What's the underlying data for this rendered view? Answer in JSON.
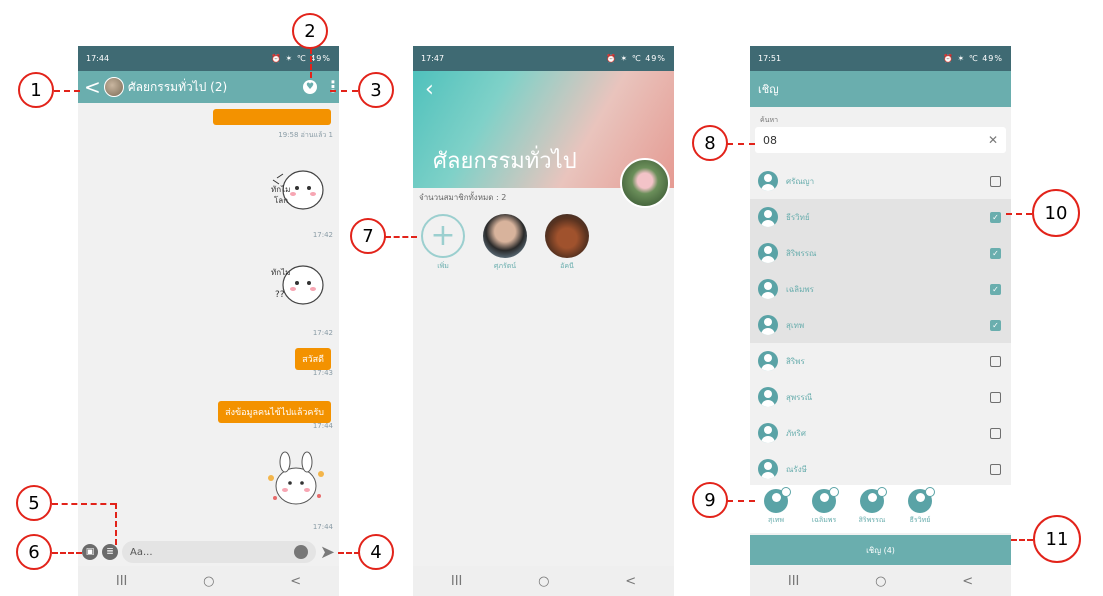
{
  "chat_screen": {
    "status_time": "17:44",
    "status_icons": "⏰ ✶ ℃ 49%",
    "back_glyph": "<",
    "group_title": "ศัลยกรรมทั่วไป (2)",
    "messages": [
      {
        "text": "",
        "time": "19:58 อ่านแล้ว 1"
      },
      {
        "time": "17:42"
      },
      {
        "time": "17:42"
      },
      {
        "text": "สวัสดี",
        "time": "17:43"
      },
      {
        "text": "ส่งข้อมูลคนไข้ไปแล้วครับ",
        "time": "17:44"
      },
      {
        "time": "17:44"
      }
    ],
    "input_placeholder": "Aa..."
  },
  "group_screen": {
    "status_time": "17:47",
    "status_icons": "⏰ ✶ ℃ 49%",
    "cover_title": "ศัลยกรรมทั่วไป",
    "member_count": "จำนวนสมาชิกทั้งหมด : 2",
    "members": [
      {
        "label": "เพิ่ม"
      },
      {
        "label": "ศุภรัตน์"
      },
      {
        "label": "อัคนี"
      }
    ]
  },
  "invite_screen": {
    "status_time": "17:51",
    "status_icons": "⏰ ✶ ℃ 49%",
    "title": "เชิญ",
    "search_label": "ค้นหา",
    "search_value": "08",
    "contacts": [
      {
        "name": "ศรัณญา",
        "checked": false
      },
      {
        "name": "ธีรวิทย์",
        "checked": true
      },
      {
        "name": "สิริพรรณ",
        "checked": true
      },
      {
        "name": "เฉลิมพร",
        "checked": true
      },
      {
        "name": "สุเทพ",
        "checked": true
      },
      {
        "name": "สิริพร",
        "checked": false
      },
      {
        "name": "สุพรรณี",
        "checked": false
      },
      {
        "name": "ภัทริศ",
        "checked": false
      },
      {
        "name": "ณรังษี",
        "checked": false
      }
    ],
    "selected": [
      "สุเทพ",
      "เฉลิมพร",
      "สิริพรรณ",
      "ธีรวิทย์"
    ],
    "invite_button": "เชิญ (4)"
  },
  "nav": {
    "recent": "III",
    "home": "○",
    "back": "<"
  },
  "callouts": [
    "1",
    "2",
    "3",
    "4",
    "5",
    "6",
    "7",
    "8",
    "9",
    "10",
    "11"
  ],
  "colors": {
    "teal": "#6aaeae",
    "orange": "#f39200",
    "callout_red": "#e2231a"
  }
}
